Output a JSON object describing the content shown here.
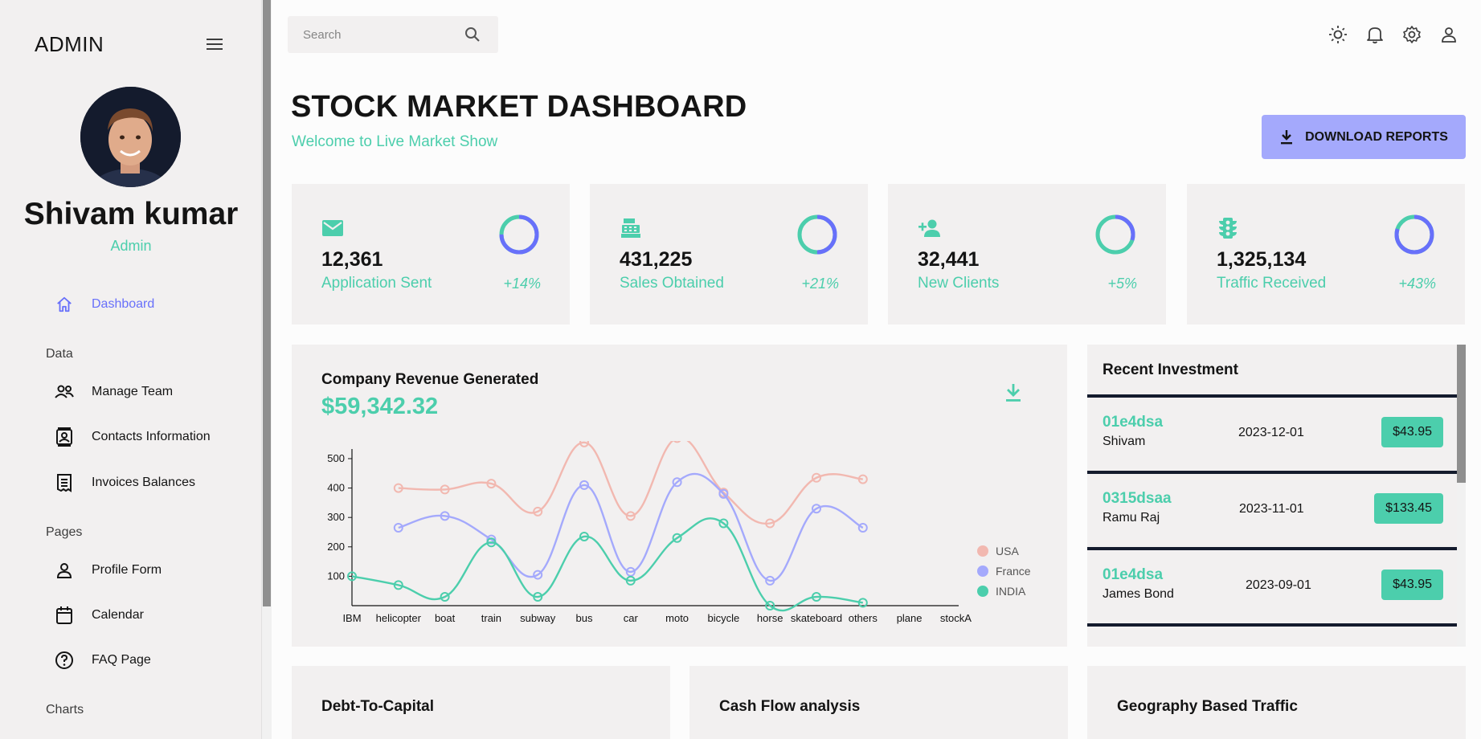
{
  "sidebar": {
    "brand": "ADMIN",
    "user_name": "Shivam kumar",
    "user_role": "Admin",
    "sections": {
      "data": "Data",
      "pages": "Pages",
      "charts": "Charts"
    },
    "items": {
      "dashboard": "Dashboard",
      "manage_team": "Manage Team",
      "contacts": "Contacts Information",
      "invoices": "Invoices Balances",
      "profile": "Profile Form",
      "calendar": "Calendar",
      "faq": "FAQ Page"
    },
    "active_color": "#6870fa"
  },
  "topbar": {
    "search_placeholder": "Search",
    "icons": [
      "light-mode-icon",
      "notifications-icon",
      "settings-icon",
      "user-icon"
    ]
  },
  "header": {
    "title": "STOCK MARKET DASHBOARD",
    "subtitle": "Welcome to Live Market Show",
    "download_label": "DOWNLOAD REPORTS"
  },
  "stats": [
    {
      "icon": "email-icon",
      "value": "12,361",
      "label": "Application Sent",
      "change": "+14%",
      "progress": 0.75
    },
    {
      "icon": "point-of-sale-icon",
      "value": "431,225",
      "label": "Sales Obtained",
      "change": "+21%",
      "progress": 0.5
    },
    {
      "icon": "person-add-icon",
      "value": "32,441",
      "label": "New Clients",
      "change": "+5%",
      "progress": 0.3
    },
    {
      "icon": "traffic-icon",
      "value": "1,325,134",
      "label": "Traffic Received",
      "change": "+43%",
      "progress": 0.8
    }
  ],
  "revenue": {
    "title": "Company Revenue Generated",
    "amount": "$59,342.32"
  },
  "investments": {
    "title": "Recent Investment",
    "rows": [
      {
        "id": "01e4dsa",
        "user": "Shivam",
        "date": "2023-12-01",
        "amount": "$43.95"
      },
      {
        "id": "0315dsaa",
        "user": "Ramu Raj",
        "date": "2023-11-01",
        "amount": "$133.45"
      },
      {
        "id": "01e4dsa",
        "user": "James Bond",
        "date": "2023-09-01",
        "amount": "$43.95"
      }
    ]
  },
  "bottom_panels": {
    "debt": "Debt-To-Capital",
    "cashflow": "Cash Flow analysis",
    "geo": "Geography Based Traffic"
  },
  "colors": {
    "accent_green": "#4cceac",
    "accent_blue": "#6870fa",
    "button_bg": "#a4a9fc",
    "panel_bg": "#f2f0f0",
    "dark": "#141b2d"
  },
  "chart_data": {
    "type": "line",
    "categories": [
      "IBM",
      "helicopter",
      "boat",
      "train",
      "subway",
      "bus",
      "car",
      "moto",
      "bicycle",
      "horse",
      "skateboard",
      "others",
      "plane",
      "stockA"
    ],
    "yticks": [
      100,
      200,
      300,
      400,
      500
    ],
    "ylim": [
      0,
      560
    ],
    "legend_position": "right",
    "series": [
      {
        "name": "USA",
        "color": "#f2b8b0",
        "start": 1,
        "values": [
          400,
          395,
          415,
          320,
          555,
          305,
          570,
          385,
          280,
          435,
          430
        ]
      },
      {
        "name": "France",
        "color": "#a4a9fc",
        "start": 1,
        "values": [
          265,
          305,
          225,
          105,
          410,
          115,
          420,
          380,
          85,
          330,
          265
        ]
      },
      {
        "name": "INDIA",
        "color": "#4cceac",
        "start": 0,
        "values": [
          100,
          70,
          30,
          215,
          30,
          235,
          85,
          230,
          280,
          0,
          30,
          10
        ]
      }
    ]
  }
}
